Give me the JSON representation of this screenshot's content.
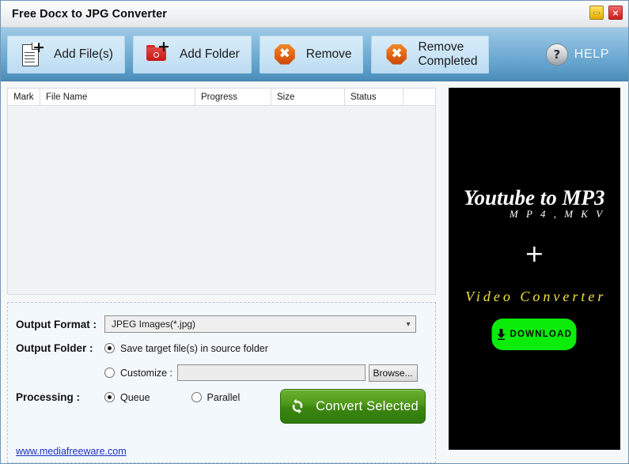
{
  "window": {
    "title": "Free Docx to JPG Converter",
    "minimize_label": "",
    "close_label": "×"
  },
  "toolbar": {
    "buttons": [
      {
        "label": "Add File(s)",
        "icon": "document-plus-icon"
      },
      {
        "label": "Add Folder",
        "icon": "folder-plus-icon"
      },
      {
        "label": "Remove",
        "icon": "remove-octagon-icon"
      },
      {
        "label": "Remove\nCompleted",
        "icon": "remove-octagon-icon"
      }
    ],
    "help": {
      "label": "HELP",
      "icon": "question-mark-icon",
      "glyph": "?"
    }
  },
  "file_list": {
    "columns": [
      "Mark",
      "File Name",
      "Progress",
      "Size",
      "Status",
      ""
    ],
    "rows": []
  },
  "settings": {
    "output_format": {
      "label": "Output Format :",
      "value": "JPEG Images(*.jpg)",
      "chevron": "⌄"
    },
    "output_folder": {
      "label": "Output Folder :",
      "option_source": "Save target file(s) in source folder",
      "option_source_selected": true,
      "option_customize": "Customize :",
      "option_customize_selected": false,
      "customize_path": "",
      "browse_label": "Browse..."
    },
    "processing": {
      "label": "Processing :",
      "option_queue": "Queue",
      "option_queue_selected": true,
      "option_parallel": "Parallel",
      "option_parallel_selected": false
    },
    "convert_button": {
      "label": "Convert Selected",
      "icon": "recycle-icon"
    },
    "site_link": "www.mediafreeware.com"
  },
  "ad": {
    "title": "Youtube to MP3",
    "subtitle": "M P 4 ,  M K V",
    "plus": "+",
    "subtitle2": "Video Converter",
    "download_label": "DOWNLOAD",
    "download_icon": "download-arrow-icon"
  },
  "colors": {
    "toolbar_top": "#9fcae6",
    "toolbar_bottom": "#4a8cb8",
    "toolbar_button": "#cbe5f6",
    "convert_green": "#4f9a1b",
    "ad_background": "#000000",
    "ad_accent_yellow": "#f2e33a",
    "download_green": "#0bec0b",
    "link_blue": "#1a2fbf",
    "close_red": "#e03a3a",
    "minimize_yellow": "#f6c623",
    "remove_orange": "#e2620f",
    "folder_red": "#c41717"
  }
}
